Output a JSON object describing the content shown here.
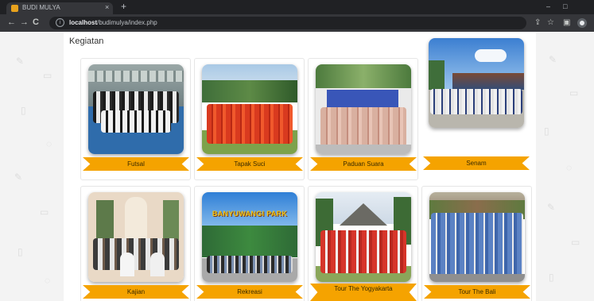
{
  "browser": {
    "tab_title": "BUDI MULYA",
    "tab_close": "×",
    "new_tab": "+",
    "url_host": "localhost",
    "url_path": "/budimulya/index.php"
  },
  "page": {
    "section_title": "Kegiatan"
  },
  "activities": [
    {
      "label": "Futsal"
    },
    {
      "label": "Tapak Suci"
    },
    {
      "label": "Paduan Suara"
    },
    {
      "label": "Senam"
    },
    {
      "label": "Kajian"
    },
    {
      "label": "Rekreasi"
    },
    {
      "label": "Tour The Yogyakarta"
    },
    {
      "label": "Tour The Bali"
    }
  ],
  "photo_signs": {
    "rekreasi": "BANYUWANGI PARK"
  },
  "colors": {
    "ribbon": "#f5a300",
    "chrome_dark": "#202124",
    "page_bg": "#f3f3f3"
  },
  "icons": [
    "back-arrow-icon",
    "forward-arrow-icon",
    "reload-icon",
    "info-icon",
    "share-icon",
    "star-icon",
    "sidebar-icon",
    "profile-avatar"
  ]
}
